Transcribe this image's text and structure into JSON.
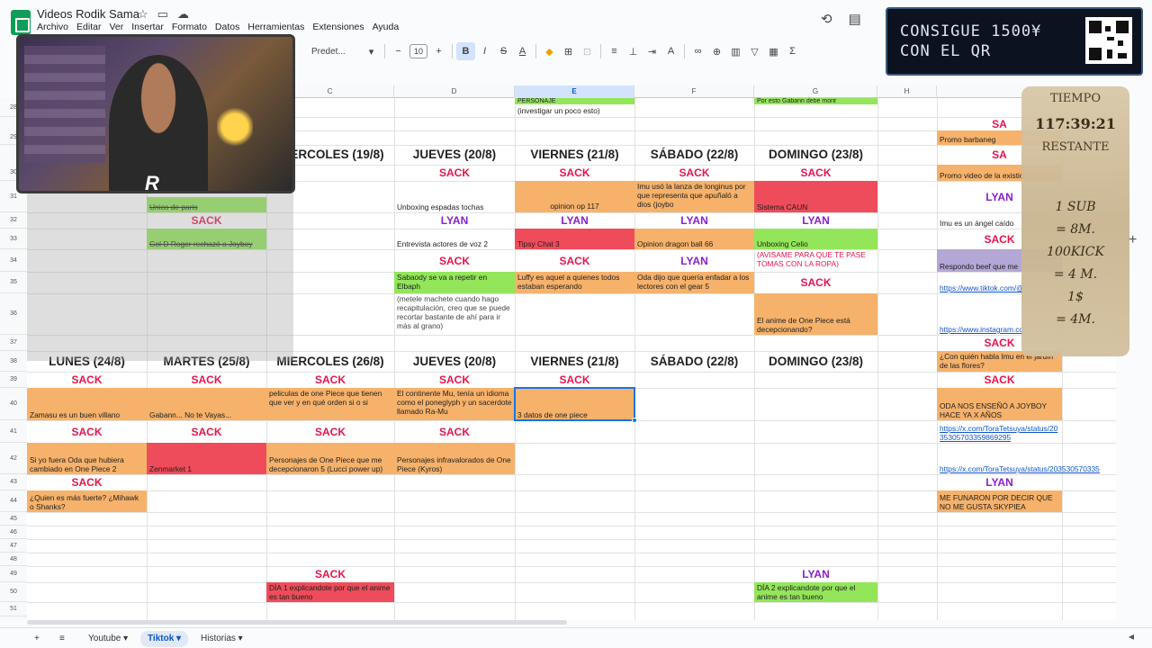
{
  "doc": {
    "title": "Videos Rodik Sama",
    "menu": [
      "Archivo",
      "Editar",
      "Ver",
      "Insertar",
      "Formato",
      "Datos",
      "Herramientas",
      "Extensiones",
      "Ayuda"
    ]
  },
  "toolbar": {
    "font": "Predet...",
    "font_size": "10"
  },
  "icons": {
    "star": "star-icon",
    "move": "folder-icon",
    "cloud": "cloud-icon",
    "history": "history-icon",
    "comment": "comment-icon"
  },
  "banner": {
    "line1": "CONSIGUE 1500¥",
    "line2": "CON EL QR"
  },
  "timer": {
    "label": "TIEMPO",
    "value": "117:39:21",
    "remaining": "RESTANTE",
    "rule1": "1 SUB",
    "rule1b": "= 8M.",
    "rule2": "100KICK",
    "rule2b": "= 4 M.",
    "rule3": "1$",
    "rule3b": "= 4M."
  },
  "columns": [
    "C",
    "D",
    "E",
    "F",
    "G",
    "H"
  ],
  "rows": [
    "28",
    "29",
    "30",
    "31",
    "32",
    "33",
    "34",
    "35",
    "36",
    "37",
    "38",
    "39",
    "40",
    "41",
    "42",
    "43",
    "44",
    "45",
    "46",
    "47",
    "48",
    "49",
    "50",
    "51"
  ],
  "cells": {
    "e28": "PERSONAJE",
    "e28b": "(investigar un poco esto)",
    "g28": "Por esto Gabann debe morir",
    "i29": "SA",
    "i29b": "Promo barbaneg",
    "day_c": "MIERCOLES (19/8)",
    "day_d": "JUEVES (20/8)",
    "day_e": "VIERNES (21/8)",
    "day_f": "SÁBADO (22/8)",
    "day_g": "DOMINGO (23/8)",
    "i30": "SA",
    "i30b": "Promo video de la existió",
    "d30s": "SACK",
    "e30s": "SACK",
    "f30s": "SACK",
    "g30s": "SACK",
    "d31": "Unboxing espadas tochas",
    "e31": "opinion op 117",
    "f31": "Imu usó la lanza de longinus por que representa que apuñaló a dios (joybo",
    "g31": "Sistema CAUN",
    "i31": "LYAN",
    "b31": "Unico de paris",
    "b32": "SACK",
    "d32": "LYAN",
    "e32": "LYAN",
    "f32": "LYAN",
    "g32": "LYAN",
    "i32": "Imu es un ángel caído",
    "b33": "Gol D Roger rechazó a Joyboy",
    "d33": "Entrevista actores de voz 2",
    "e33": "Tipsy Chat 3",
    "f33": "Opinion dragon ball 66",
    "g33": "Unboxing Celio",
    "i33": "SACK",
    "d34": "SACK",
    "e34": "SACK",
    "f34": "LYAN",
    "g34": "(AVISAME PARA QUE TE PASE TOMAS CON LA ROPA)",
    "i34": "Respondo beef que me",
    "d35": "Sabaody se va a repetir en Elbaph",
    "e35": "Luffy es aquel a quienes todos estaban esperando",
    "f35": "Oda dijo que quería enfadar a los lectores con el gear 5",
    "g35": "SACK",
    "i35": "https://www.tiktok.com/@",
    "d36": "(metele machete cuando hago recapitulación, creo que se puede recortar bastante de ahí para ir más al grano)",
    "g36": "El anime de One Piece está decepcionando?",
    "i36": "https://www.instagram.co",
    "i37": "SACK",
    "i37b": "¿Con quién habla Imu en el jardín de las flores?",
    "day2_a": "LUNES (24/8)",
    "day2_b": "MARTES (25/8)",
    "day2_c": "MIERCOLES (26/8)",
    "day2_d": "JUEVES (20/8)",
    "day2_e": "VIERNES (21/8)",
    "day2_f": "SÁBADO (22/8)",
    "day2_g": "DOMINGO (23/8)",
    "a39": "SACK",
    "b39": "SACK",
    "c39": "SACK",
    "d39": "SACK",
    "e39": "SACK",
    "i39": "SACK",
    "a40": "Zamasu es un buen villano",
    "b40": "Gabann... No te Vayas...",
    "c40": "peliculas de one Piece que tienen que ver y en qué orden si o si",
    "d40": "El continente Mu, tenía un idioma como el poneglyph y un sacerdote llamado Ra-Mu",
    "e40": "3 datos de one piece",
    "i40": "ODA NOS ENSEÑÓ A JOYBOY HACE YA X AÑOS",
    "a41": "SACK",
    "b41": "SACK",
    "c41": "SACK",
    "d41": "SACK",
    "i41": "https://x.com/ToraTetsuya/status/2035305703359869295",
    "a42": "Si yo fuera Oda que hubiera cambiado en One Piece 2",
    "b42": "Zenmarket 1",
    "c42": "Personajes de One Piece que me decepcionaron 5 (Lucci power up)",
    "d42": "Personajes infravalorados de One Piece (Kyros)",
    "i42": "https://x.com/ToraTetsuya/status/203530570335",
    "a43": "SACK",
    "i43": "LYAN",
    "a44": "¿Quien es más fuerte? ¿Mihawk o Shanks?",
    "i44": "ME FUNARON POR DECIR QUE NO ME GUSTA SKYPIEA",
    "c49": "SACK",
    "g49": "LYAN",
    "c50": "DÍA 1 explicandote por que el anime es tan bueno",
    "g50": "DÍA 2 explicandote por que el anime es tan bueno"
  },
  "tabs": {
    "add": "+",
    "list": "≡",
    "t1": "Youtube",
    "t2": "Tiktok",
    "t3": "Historias"
  },
  "colors": {
    "sack": "#e8144c",
    "lyan": "#8a1fd1",
    "orange": "#f6b26b",
    "green": "#93e65a",
    "red": "#ee4c5a"
  }
}
